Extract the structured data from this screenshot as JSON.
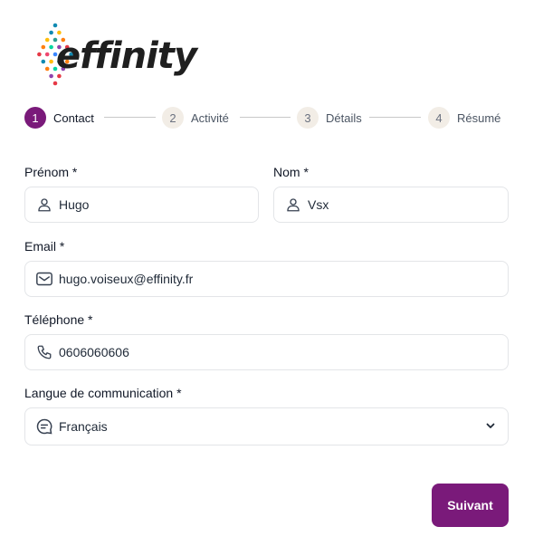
{
  "brand": {
    "logo_text": "effinity",
    "accent_color": "#7a1a7a"
  },
  "stepper": {
    "steps": [
      {
        "number": "1",
        "label": "Contact",
        "active": true
      },
      {
        "number": "2",
        "label": "Activité",
        "active": false
      },
      {
        "number": "3",
        "label": "Détails",
        "active": false
      },
      {
        "number": "4",
        "label": "Résumé",
        "active": false
      }
    ]
  },
  "form": {
    "first_name": {
      "label": "Prénom *",
      "value": "Hugo",
      "icon": "user-icon"
    },
    "last_name": {
      "label": "Nom *",
      "value": "Vsx",
      "icon": "user-icon"
    },
    "email": {
      "label": "Email *",
      "value": "hugo.voiseux@effinity.fr",
      "icon": "mail-icon"
    },
    "phone": {
      "label": "Téléphone *",
      "value": "0606060606",
      "icon": "phone-icon"
    },
    "language": {
      "label": "Langue de communication *",
      "value": "Français",
      "icon": "chat-icon"
    }
  },
  "actions": {
    "next_label": "Suivant"
  }
}
